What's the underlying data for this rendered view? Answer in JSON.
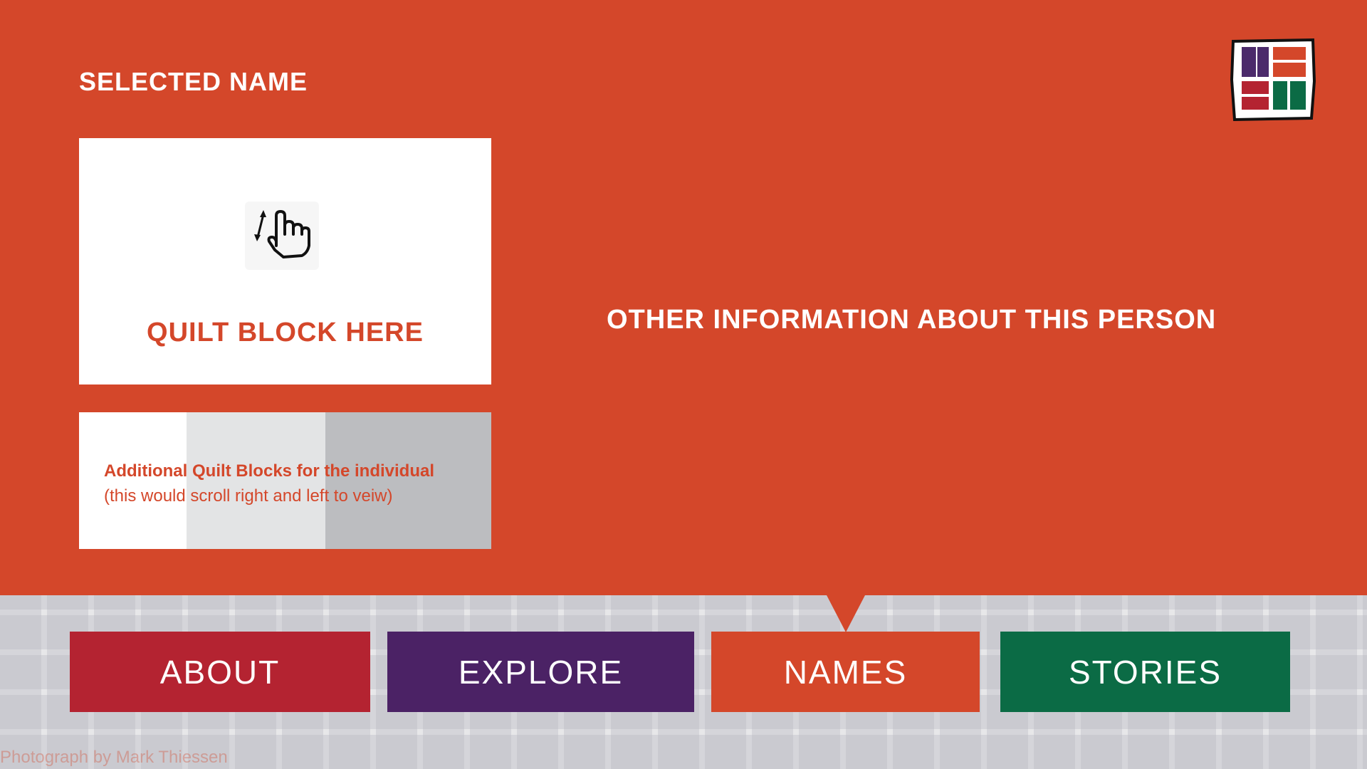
{
  "header": {
    "title": "SELECTED NAME"
  },
  "logo": {
    "icon": "quilt-logo-icon",
    "colors": [
      "#4b2a6b",
      "#d4472a",
      "#b42331",
      "#0b6b45"
    ]
  },
  "quilt_block": {
    "label": "QUILT BLOCK HERE",
    "icon": "pinch-zoom-gesture-icon"
  },
  "additional_blocks": {
    "line1": "Additional Quilt Blocks for the individual",
    "line2": "(this would scroll right and left to veiw)"
  },
  "details": {
    "heading": "OTHER INFORMATION ABOUT THIS PERSON"
  },
  "nav": {
    "active": "NAMES",
    "items": [
      {
        "label": "ABOUT",
        "color": "#b42331"
      },
      {
        "label": "EXPLORE",
        "color": "#4b2265"
      },
      {
        "label": "NAMES",
        "color": "#d4472a"
      },
      {
        "label": "STORIES",
        "color": "#0b6b45"
      }
    ]
  },
  "footer": {
    "credit": "Photograph by Mark Thiessen"
  },
  "colors": {
    "background": "#d4472a",
    "white": "#ffffff"
  }
}
